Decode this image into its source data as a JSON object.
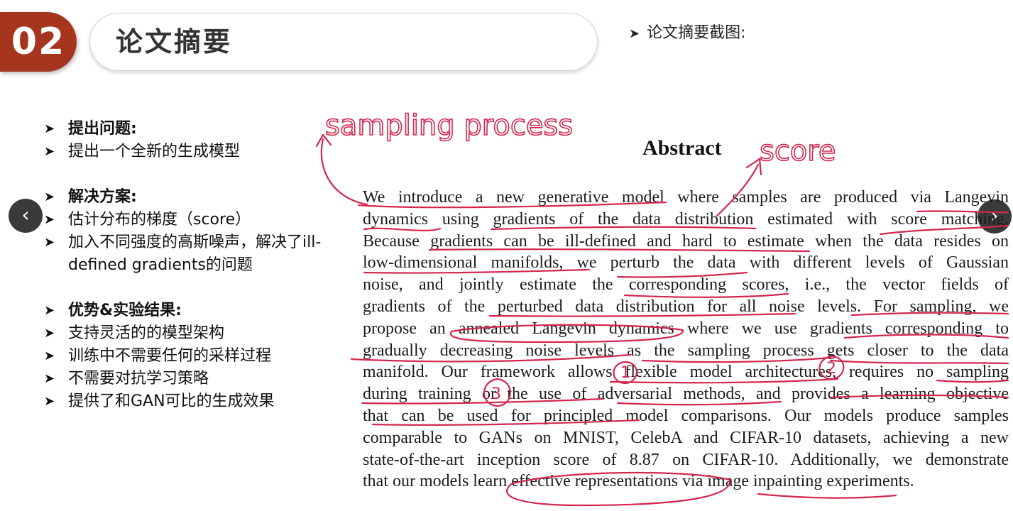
{
  "section": {
    "number": "02",
    "title": "论文摘要",
    "screenshot_label": "论文摘要截图:"
  },
  "bullets": [
    {
      "text": "提出问题:",
      "head": true
    },
    {
      "text": "提出一个全新的生成模型",
      "head": false
    },
    {
      "gap": true
    },
    {
      "text": "解决方案:",
      "head": true
    },
    {
      "text": "估计分布的梯度（score）",
      "head": false
    },
    {
      "text": "加入不同强度的高斯噪声，解决了ill-defined gradients的问题",
      "head": false
    },
    {
      "gap": true
    },
    {
      "text": "优势&实验结果:",
      "head": true
    },
    {
      "text": "支持灵活的的模型架构",
      "head": false
    },
    {
      "text": "训练中不需要任何的采样过程",
      "head": false
    },
    {
      "text": "不需要对抗学习策略",
      "head": false
    },
    {
      "text": "提供了和GAN可比的生成效果",
      "head": false
    }
  ],
  "abstract": {
    "heading": "Abstract",
    "lines": [
      "We introduce a new generative model where samples are produced via Langevin",
      "dynamics using gradients of the data distribution estimated with score matching.",
      "Because gradients can be ill-defined and hard to estimate when the data resides on",
      "low-dimensional manifolds, we perturb the data with different levels of Gaussian",
      "noise, and jointly estimate the corresponding scores, i.e., the vector fields of",
      "gradients of the perturbed data distribution for all noise levels. For sampling, we",
      "propose an annealed Langevin dynamics where we use gradients corresponding to",
      "gradually decreasing noise levels as the sampling process gets closer to the data",
      "manifold. Our framework allows flexible model architectures, requires no sampling",
      "during training or the use of adversarial methods, and provides a learning objective",
      "that can be used for principled model comparisons. Our models produce samples",
      "comparable to GANs on MNIST, CelebA and CIFAR-10 datasets, achieving a new",
      "state-of-the-art inception score of 8.87 on CIFAR-10. Additionally, we demonstrate",
      "that our models learn effective representations via image inpainting experiments."
    ]
  },
  "annotations": {
    "sampling_note": "sampling process",
    "score_note": "score",
    "circled_numbers": [
      "1",
      "2",
      "3"
    ],
    "ink_color": "#d4264e"
  },
  "nav": {
    "prev_glyph": "‹",
    "next_glyph": "›",
    "arrow_glyph": "➤"
  }
}
